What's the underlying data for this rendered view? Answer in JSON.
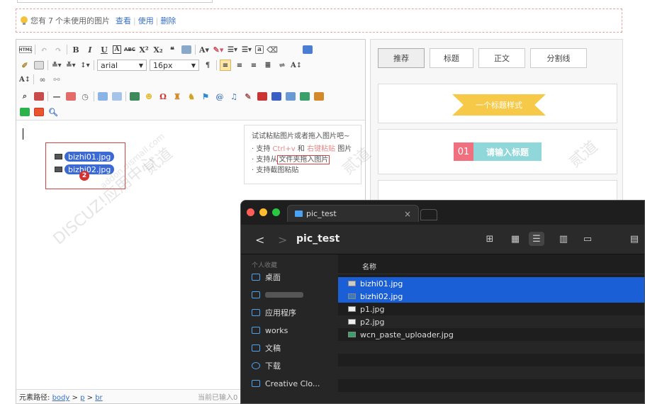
{
  "notice": {
    "text_prefix": "您有",
    "count": "7",
    "text_suffix": "个未使用的图片",
    "view_label": "查看",
    "use_label": "使用",
    "delete_label": "删除",
    "separator": "|"
  },
  "toolbar": {
    "font_family": "arial",
    "font_size": "16px",
    "icons": [
      "html-icon",
      "undo-icon",
      "redo-icon",
      "bold-icon",
      "italic-icon",
      "underline-icon",
      "font-border-icon",
      "strikethrough-icon",
      "superscript-icon",
      "subscript-icon",
      "blockquote-icon",
      "paste-plain-icon",
      "forecolor-icon",
      "backcolor-icon",
      "ordered-list-icon",
      "unordered-list-icon",
      "select-all-icon",
      "clear-format-icon",
      "preview-icon",
      "format-painter-icon",
      "clean-doc-icon",
      "row-spacing-top-icon",
      "row-spacing-bottom-icon",
      "line-height-icon",
      "paragraph-icon",
      "justify-left-icon",
      "justify-center-icon",
      "justify-right-icon",
      "justify-justify-icon",
      "text-direction-icon",
      "font-scale-icon",
      "link-icon",
      "unlink-icon",
      "search-replace-icon",
      "template-icon",
      "horizontal-rule-icon",
      "date-icon",
      "time-icon",
      "table-icon",
      "merge-icon",
      "image-icon",
      "emotion-icon",
      "special-char-icon",
      "map-icon",
      "anchor-icon",
      "code-icon",
      "music-icon",
      "attachment-icon",
      "video-icon",
      "save-icon",
      "draft-icon",
      "insert-frame-icon",
      "wechat-icon",
      "paste-icon",
      "zoom-icon"
    ]
  },
  "editor": {
    "files": [
      "bizhi01.jpg",
      "bizhi02.jpg"
    ],
    "badge": "2",
    "tip": {
      "head": "试试粘贴图片或者拖入图片吧~",
      "line1_prefix": "· 支持",
      "line1_ctrlv": "Ctrl+v",
      "line1_and": "和",
      "line1_rightclick": "右键粘贴",
      "line1_suffix": "图片",
      "line2_prefix": "· 支持从",
      "line2_hl": "文件夹拖入图片",
      "line3": "· 支持截图粘贴"
    }
  },
  "statusbar": {
    "path_label": "元素路径:",
    "path": [
      "body",
      "p",
      "br"
    ],
    "path_sep": ">",
    "count_text": "当前已输入0"
  },
  "rpanel": {
    "tabs": [
      "推荐",
      "标题",
      "正文",
      "分割线"
    ],
    "card1_text": "一个标题样式",
    "card2_num": "01",
    "card2_text": "请输入标题"
  },
  "watermarks": [
    "DISCUZ!应用中心",
    "addon.dismall.com",
    "贰道"
  ],
  "finder": {
    "tab_title": "pic_test",
    "tab_close": "×",
    "title": "pic_test",
    "back": "<",
    "forward": ">",
    "sidebar_head": "个人收藏",
    "sidebar": [
      {
        "label": "桌面",
        "icon": "desktop-icon"
      },
      {
        "label": "",
        "icon": "home-icon"
      },
      {
        "label": "应用程序",
        "icon": "applications-icon"
      },
      {
        "label": "works",
        "icon": "folder-icon"
      },
      {
        "label": "文稿",
        "icon": "documents-icon"
      },
      {
        "label": "下载",
        "icon": "downloads-icon"
      },
      {
        "label": "Creative Clo...",
        "icon": "folder-icon"
      }
    ],
    "col_name": "名称",
    "files": [
      {
        "name": "bizhi01.jpg",
        "selected": true
      },
      {
        "name": "bizhi02.jpg",
        "selected": true
      },
      {
        "name": "p1.jpg",
        "selected": false
      },
      {
        "name": "p2.jpg",
        "selected": false
      },
      {
        "name": "wcn_paste_uploader.jpg",
        "selected": false
      }
    ],
    "colors": {
      "selection": "#1a5fd6",
      "close": "#ff5f57",
      "minimize": "#febc2e",
      "zoom": "#28c840"
    }
  }
}
